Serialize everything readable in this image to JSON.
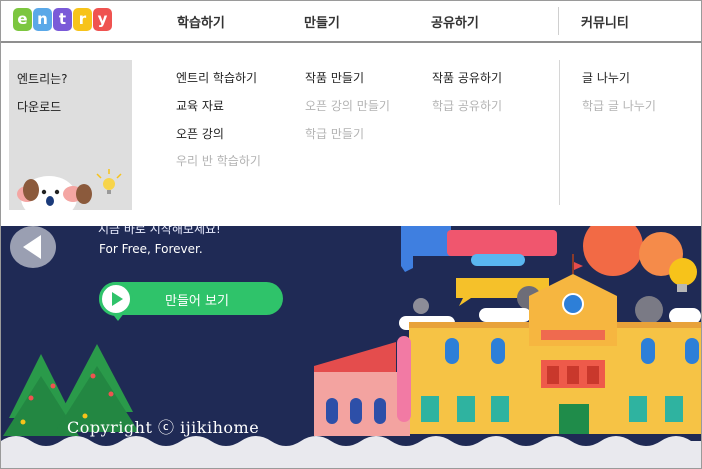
{
  "logo": {
    "letters": [
      "e",
      "n",
      "t",
      "r",
      "y"
    ],
    "colors": [
      "#7cc63f",
      "#5aa8e8",
      "#7a5ad8",
      "#f7c31a",
      "#ef5350"
    ]
  },
  "nav": {
    "learn": "학습하기",
    "create": "만들기",
    "share": "공유하기",
    "community": "커뮤니티"
  },
  "side": {
    "about": "엔트리는?",
    "download": "다운로드"
  },
  "menu": {
    "learn": [
      "엔트리 학습하기",
      "교육 자료",
      "오픈 강의",
      "우리 반 학습하기"
    ],
    "create": [
      "작품 만들기",
      "오픈 강의 만들기",
      "학급 만들기"
    ],
    "share": [
      "작품 공유하기",
      "학급 공유하기"
    ],
    "community": [
      "글 나누기",
      "학급 글 나누기"
    ]
  },
  "hero": {
    "line1": "지금 바로 시작해보세요!",
    "line2": "For Free, Forever.",
    "cta_label": "만들어 보기",
    "copyright": "Copyright ⓒ ijikihome"
  },
  "colors": {
    "accent_green": "#2fc36a",
    "hero_bg": "#1f2a55",
    "nav_text": "#333333",
    "disabled_text": "#b3b3b3"
  },
  "icons": [
    "entry-mascot-icon",
    "play-icon",
    "arrow-left-icon",
    "lightbulb-icon"
  ]
}
